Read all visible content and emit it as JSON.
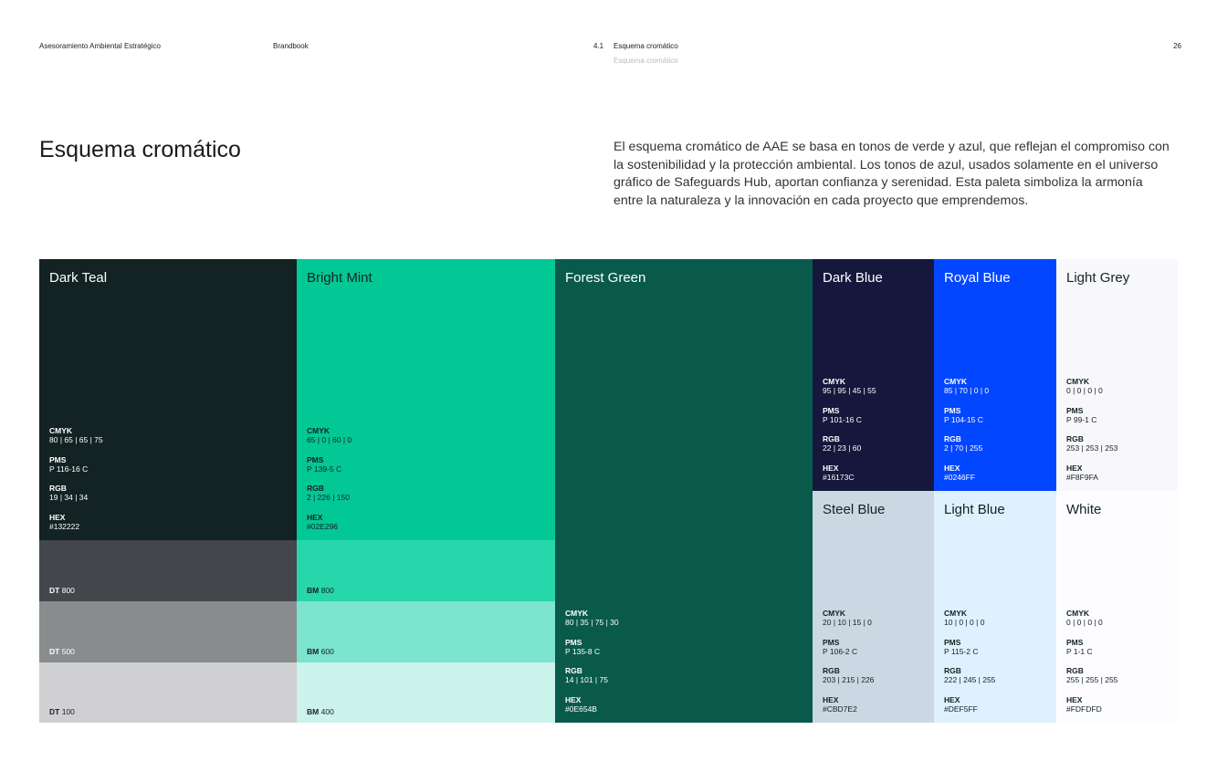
{
  "header": {
    "company": "Asesoramiento Ambiental Estratégico",
    "doc": "Brandbook",
    "section_number": "4.1",
    "section_title": "Esquema cromático",
    "section_sub": "Esquema cromático",
    "page_number": "26"
  },
  "title": "Esquema cromático",
  "intro": "El esquema cromático de AAE se basa en tonos de verde y azul, que reflejan el compromiso con la sostenibilidad y la protección ambiental. Los tonos de azul, usados solamente en el universo gráfico de Safeguards Hub, aportan confianza y serenidad. Esta paleta simboliza la armonía entre la naturaleza y la innovación en cada proyecto que emprendemos.",
  "spec_keys": {
    "cmyk": "CMYK",
    "pms": "PMS",
    "rgb": "RGB",
    "hex": "HEX"
  },
  "colors": {
    "dark_teal": {
      "name": "Dark Teal",
      "cmyk": "80 | 65 | 65 | 75",
      "pms": "P 116-16 C",
      "rgb": "19 | 34 | 34",
      "hex": "#132222",
      "bg": "#132222",
      "fg": "#ffffff"
    },
    "bright_mint": {
      "name": "Bright Mint",
      "cmyk": "65 | 0 | 60 | 0",
      "pms": "P 139-5 C",
      "rgb": "2 | 226 | 150",
      "hex": "#02E296",
      "bg": "#02C896",
      "fg": "#132222"
    },
    "forest_green": {
      "name": "Forest Green",
      "cmyk": "80 | 35 | 75 | 30",
      "pms": "P 135-8 C",
      "rgb": "14 | 101 | 75",
      "hex": "#0E654B",
      "bg": "#0A5A4C",
      "fg": "#ffffff"
    },
    "dark_blue": {
      "name": "Dark Blue",
      "cmyk": "95 | 95 | 45 | 55",
      "pms": "P 101-16 C",
      "rgb": "22 | 23 | 60",
      "hex": "#16173C",
      "bg": "#16173C",
      "fg": "#ffffff"
    },
    "royal_blue": {
      "name": "Royal Blue",
      "cmyk": "85 | 70 | 0 | 0",
      "pms": "P 104-15 C",
      "rgb": "2 | 70 | 255",
      "hex": "#0246FF",
      "bg": "#0246FF",
      "fg": "#ffffff"
    },
    "light_grey": {
      "name": "Light Grey",
      "cmyk": "0 | 0 | 0 | 0",
      "pms": "P 99-1 C",
      "rgb": "253 | 253 | 253",
      "hex": "#F8F9FA",
      "bg": "#F8F8FC",
      "fg": "#132222"
    },
    "steel_blue": {
      "name": "Steel Blue",
      "cmyk": "20 | 10 | 15 | 0",
      "pms": "P 106-2 C",
      "rgb": "203 | 215 | 226",
      "hex": "#CBD7E2",
      "bg": "#CBD7E2",
      "fg": "#132222"
    },
    "light_blue": {
      "name": "Light Blue",
      "cmyk": "10 | 0 | 0 | 0",
      "pms": "P 115-2 C",
      "rgb": "222 | 245 | 255",
      "hex": "#DEF5FF",
      "bg": "#DEF1FF",
      "fg": "#132222"
    },
    "white": {
      "name": "White",
      "cmyk": "0 | 0 | 0 | 0",
      "pms": "P 1-1 C",
      "rgb": "255 | 255 | 255",
      "hex": "#FDFDFD",
      "bg": "#FDFDFF",
      "fg": "#132222"
    }
  },
  "tints": {
    "dt": {
      "prefix": "DT",
      "items": [
        {
          "value": "800",
          "bg": "#43474B",
          "fg": "#ffffff"
        },
        {
          "value": "500",
          "bg": "#898C8D",
          "fg": "#ffffff"
        },
        {
          "value": "100",
          "bg": "#D0D0D2",
          "fg": "#132222"
        }
      ]
    },
    "bm": {
      "prefix": "BM",
      "items": [
        {
          "value": "800",
          "bg": "#28D6AC",
          "fg": "#132222"
        },
        {
          "value": "600",
          "bg": "#7CE3CF",
          "fg": "#132222"
        },
        {
          "value": "400",
          "bg": "#CCF2EC",
          "fg": "#132222"
        }
      ]
    }
  }
}
